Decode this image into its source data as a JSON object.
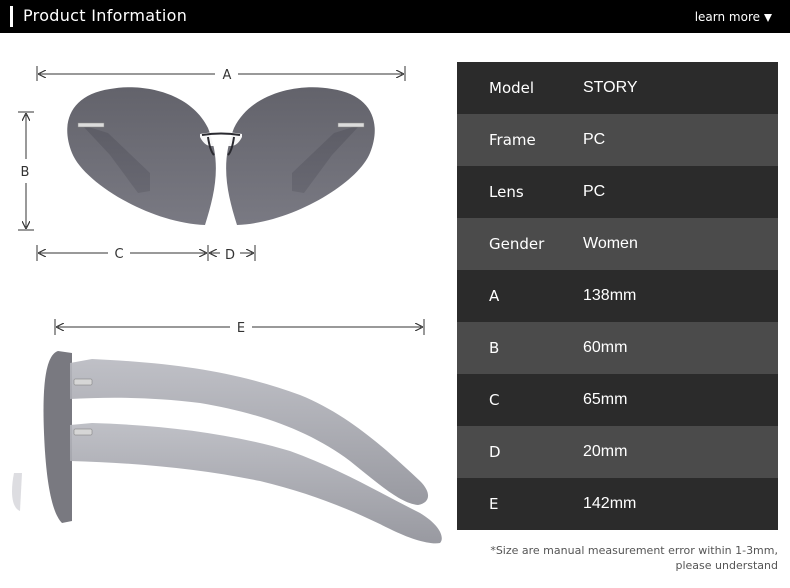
{
  "header": {
    "title": "Product Information",
    "learn_more": "learn more"
  },
  "diagram": {
    "labels": {
      "a": "A",
      "b": "B",
      "c": "C",
      "d": "D",
      "e": "E"
    }
  },
  "specs": [
    {
      "key": "Model",
      "value": "STORY"
    },
    {
      "key": "Frame",
      "value": "PC"
    },
    {
      "key": "Lens",
      "value": "PC"
    },
    {
      "key": "Gender",
      "value": "Women"
    },
    {
      "key": "A",
      "value": "138mm"
    },
    {
      "key": "B",
      "value": "60mm"
    },
    {
      "key": "C",
      "value": "65mm"
    },
    {
      "key": "D",
      "value": "20mm"
    },
    {
      "key": "E",
      "value": "142mm"
    }
  ],
  "note": {
    "line1": "*Size are manual measurement error within 1-3mm,",
    "line2": "please understand"
  },
  "colors": {
    "header_bg": "#000000",
    "row_dark": "#2b2b2b",
    "row_light": "#4b4b4b",
    "lens": "#5c5c66"
  }
}
